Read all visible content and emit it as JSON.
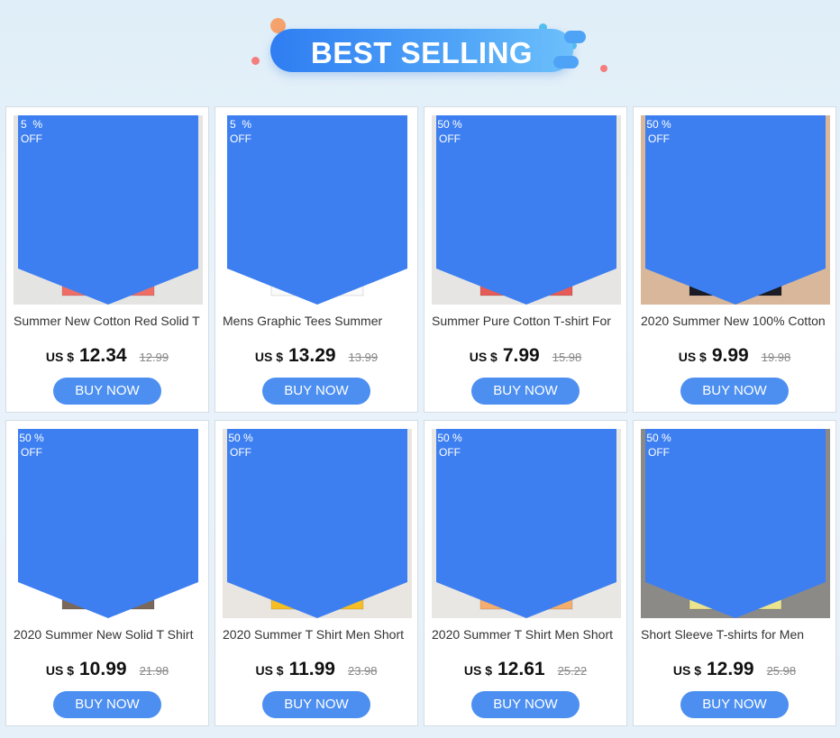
{
  "banner": {
    "title": "BEST SELLING"
  },
  "products": [
    {
      "badge_pct": "5  %",
      "badge_off": "OFF",
      "title": "Summer New Cotton Red Solid T",
      "currency": "US $",
      "price": "12.34",
      "old_price": "12.99",
      "button": "BUY NOW",
      "shirt_color": "#ee6e66",
      "bg_color": "#e4e4e2",
      "icon": "red-tshirt-image"
    },
    {
      "badge_pct": "5  %",
      "badge_off": "OFF",
      "title": "Mens Graphic Tees Summer",
      "currency": "US $",
      "price": "13.29",
      "old_price": "13.99",
      "button": "BUY NOW",
      "shirt_color": "#fafafa",
      "bg_color": "#ffffff",
      "icon": "white-graphic-tshirt-image"
    },
    {
      "badge_pct": "50 %",
      "badge_off": "OFF",
      "title": "Summer Pure Cotton T-shirt For",
      "currency": "US $",
      "price": "7.99",
      "old_price": "15.98",
      "button": "BUY NOW",
      "shirt_color": "#e55b57",
      "bg_color": "#e6e5e3",
      "icon": "red-tshirt-image"
    },
    {
      "badge_pct": "50 %",
      "badge_off": "OFF",
      "title": "2020 Summer New 100% Cotton",
      "currency": "US $",
      "price": "9.99",
      "old_price": "19.98",
      "button": "BUY NOW",
      "shirt_color": "#1b1c26",
      "bg_color": "#d9b79a",
      "icon": "black-tshirt-image"
    },
    {
      "badge_pct": "50 %",
      "badge_off": "OFF",
      "title": "2020 Summer New Solid T Shirt",
      "currency": "US $",
      "price": "10.99",
      "old_price": "21.98",
      "button": "BUY NOW",
      "shirt_color": "#7a685a",
      "bg_color": "#ffffff",
      "icon": "brown-linen-tshirt-image"
    },
    {
      "badge_pct": "50 %",
      "badge_off": "OFF",
      "title": "2020 Summer T Shirt Men Short",
      "currency": "US $",
      "price": "11.99",
      "old_price": "23.98",
      "button": "BUY NOW",
      "shirt_color": "#f7be24",
      "bg_color": "#e9e6e1",
      "icon": "yellow-tshirt-image"
    },
    {
      "badge_pct": "50 %",
      "badge_off": "OFF",
      "title": "2020 Summer T Shirt Men Short",
      "currency": "US $",
      "price": "12.61",
      "old_price": "25.22",
      "button": "BUY NOW",
      "shirt_color": "#f4ad6c",
      "bg_color": "#e9e7e3",
      "icon": "orange-tshirt-image"
    },
    {
      "badge_pct": "50 %",
      "badge_off": "OFF",
      "title": "Short Sleeve T-shirts for Men",
      "currency": "US $",
      "price": "12.99",
      "old_price": "25.98",
      "button": "BUY NOW",
      "shirt_color": "#ece38f",
      "bg_color": "#8b8a87",
      "icon": "light-yellow-tshirt-image"
    }
  ]
}
